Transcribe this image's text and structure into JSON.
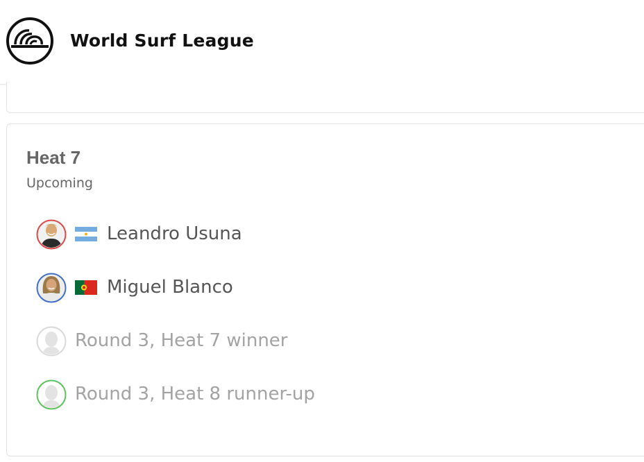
{
  "header": {
    "brand": "World Surf League",
    "logo_icon": "wave-logo-icon"
  },
  "heat": {
    "title": "Heat 7",
    "status": "Upcoming",
    "athletes": [
      {
        "name": "Leandro Usuna",
        "flag": "argentina-flag-icon",
        "ring_color": "#d94b4b",
        "placeholder": false
      },
      {
        "name": "Miguel Blanco",
        "flag": "portugal-flag-icon",
        "ring_color": "#3f6fc9",
        "placeholder": false
      },
      {
        "name": "Round 3, Heat 7 winner",
        "flag": null,
        "ring_color": "#d9d9d9",
        "placeholder": true
      },
      {
        "name": "Round 3, Heat 8 runner-up",
        "flag": null,
        "ring_color": "#5cc25c",
        "placeholder": true
      }
    ]
  },
  "colors": {
    "text_primary": "#555555",
    "text_muted": "#a3a3a3",
    "border": "#e3e3e3"
  }
}
